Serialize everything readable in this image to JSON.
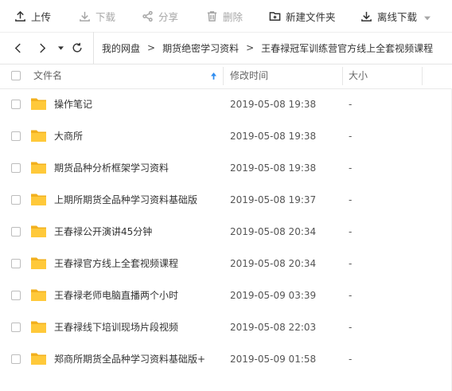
{
  "toolbar": {
    "upload": "上传",
    "download": "下载",
    "share": "分享",
    "delete": "删除",
    "new_folder": "新建文件夹",
    "offline_download": "离线下载"
  },
  "breadcrumb": {
    "items": [
      "我的网盘",
      "期货绝密学习资料",
      "王春禄冠军训练营官方线上全套视频课程"
    ],
    "separator": ">"
  },
  "table": {
    "headers": {
      "name": "文件名",
      "modified": "修改时间",
      "size": "大小"
    },
    "rows": [
      {
        "name": "操作笔记",
        "modified": "2019-05-08 19:38",
        "size": "-"
      },
      {
        "name": "大商所",
        "modified": "2019-05-08 19:38",
        "size": "-"
      },
      {
        "name": "期货品种分析框架学习资料",
        "modified": "2019-05-08 19:38",
        "size": "-"
      },
      {
        "name": "上期所期货全品种学习资料基础版",
        "modified": "2019-05-08 19:37",
        "size": "-"
      },
      {
        "name": "王春禄公开演讲45分钟",
        "modified": "2019-05-08 20:34",
        "size": "-"
      },
      {
        "name": "王春禄官方线上全套视频课程",
        "modified": "2019-05-08 20:34",
        "size": "-"
      },
      {
        "name": "王春禄老师电脑直播两个小时",
        "modified": "2019-05-09 03:39",
        "size": "-"
      },
      {
        "name": "王春禄线下培训现场片段视频",
        "modified": "2019-05-08 22:03",
        "size": "-"
      },
      {
        "name": "郑商所期货全品种学习资料基础版+",
        "modified": "2019-05-09 01:58",
        "size": "-"
      }
    ]
  },
  "colors": {
    "folder": "#ffc93a",
    "folder_tab": "#f2b01e",
    "sort_arrow": "#2e8cf0"
  }
}
